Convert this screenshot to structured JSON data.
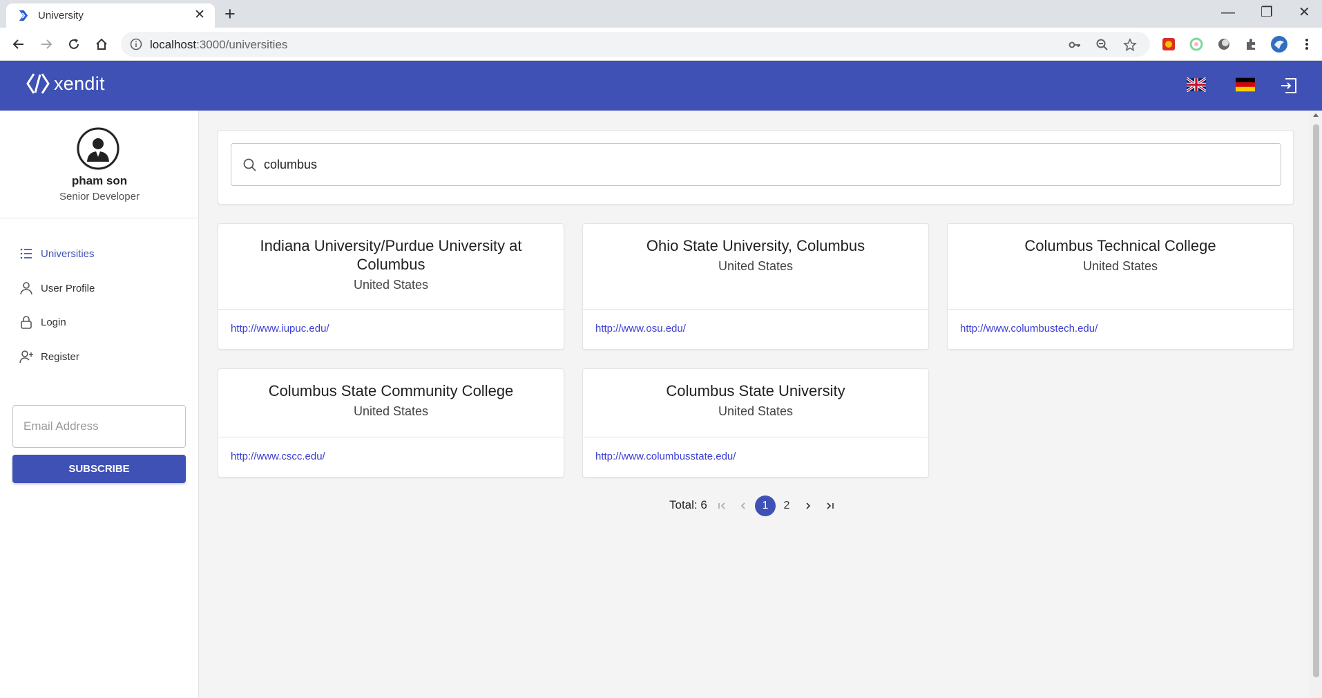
{
  "browser": {
    "tab_title": "University",
    "url_host": "localhost",
    "url_path": ":3000/universities"
  },
  "header": {
    "brand": "xendit",
    "accent": "#3f51b5"
  },
  "user": {
    "name": "pham son",
    "role": "Senior Developer"
  },
  "sidebar": {
    "items": [
      {
        "label": "Universities",
        "icon": "list-icon",
        "active": true
      },
      {
        "label": "User Profile",
        "icon": "user-icon",
        "active": false
      },
      {
        "label": "Login",
        "icon": "lock-icon",
        "active": false
      },
      {
        "label": "Register",
        "icon": "user-add-icon",
        "active": false
      }
    ],
    "email_placeholder": "Email Address",
    "subscribe_label": "SUBSCRIBE"
  },
  "search": {
    "value": "columbus"
  },
  "universities": [
    {
      "name": "Indiana University/Purdue University at Columbus",
      "country": "United States",
      "url": "http://www.iupuc.edu/"
    },
    {
      "name": "Ohio State University, Columbus",
      "country": "United States",
      "url": "http://www.osu.edu/"
    },
    {
      "name": "Columbus Technical College",
      "country": "United States",
      "url": "http://www.columbustech.edu/"
    },
    {
      "name": "Columbus State Community College",
      "country": "United States",
      "url": "http://www.cscc.edu/"
    },
    {
      "name": "Columbus State University",
      "country": "United States",
      "url": "http://www.columbusstate.edu/"
    }
  ],
  "pagination": {
    "total_label": "Total: 6",
    "pages": [
      "1",
      "2"
    ],
    "current": "1"
  }
}
